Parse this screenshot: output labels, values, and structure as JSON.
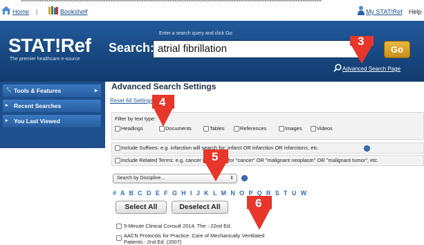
{
  "topbar": {
    "cut_text": "xxxxxxxxxxxxxxxxxxxxxxxxxxxxxxxxxxxxxxxxxxxxxxxxxxxxxxxxxxxxxxxxxxxxxxxxxxxxxxxxxxxxxxx",
    "home": "Home",
    "separator": "|",
    "bookshelf": "Bookshelf",
    "my_statref": "My STAT!Ref",
    "help": "Help"
  },
  "header": {
    "logo": "STAT!Ref",
    "tagline": "The premier healthcare e-source",
    "search_hint": "Enter a search query and click Go:",
    "search_label": "Search:",
    "search_value": "atrial fibrillation",
    "go_label": "Go",
    "advanced_link": "Advanced Search Page"
  },
  "sidebar": {
    "items": [
      {
        "label": "Tools & Features",
        "icon": "tools-icon"
      },
      {
        "label": "Recent Searches",
        "icon": "arrow-right-icon"
      },
      {
        "label": "You Last Viewed",
        "icon": "arrow-right-icon"
      }
    ]
  },
  "main": {
    "title": "Advanced Search Settings",
    "reset": "Reset All Settings",
    "filter_label": "Filter by text type:",
    "types": [
      "Headings",
      "Documents",
      "Tables",
      "References",
      "Images",
      "Videos"
    ],
    "suffixes": "Include Suffixes: e.g. infarction will search for: infarct OR infarction OR infarctions, etc.",
    "related": "Include Related Terms: e.g. cancer will search for \"cancer\" OR \"malignant neoplasm\" OR \"malignant tumor\", etc.",
    "discipline": "Search by Discipline...",
    "alphabet": "# A B C D E F G H I J K L M N O P Q R S T U W",
    "select_all": "Select All",
    "deselect_all": "Deselect All",
    "results": [
      "5-Minute Clinical Consult 2014, The - 22nd Ed.",
      "AACN Protocols for Practice: Care of Mechanically Ventilated",
      "Patients - 2nd Ed. (2007)"
    ]
  },
  "callouts": [
    "3",
    "4",
    "5",
    "6"
  ],
  "colors": {
    "accent_red": "#e8362b",
    "header_blue": "#17467f",
    "go_gold": "#d9a22c"
  }
}
